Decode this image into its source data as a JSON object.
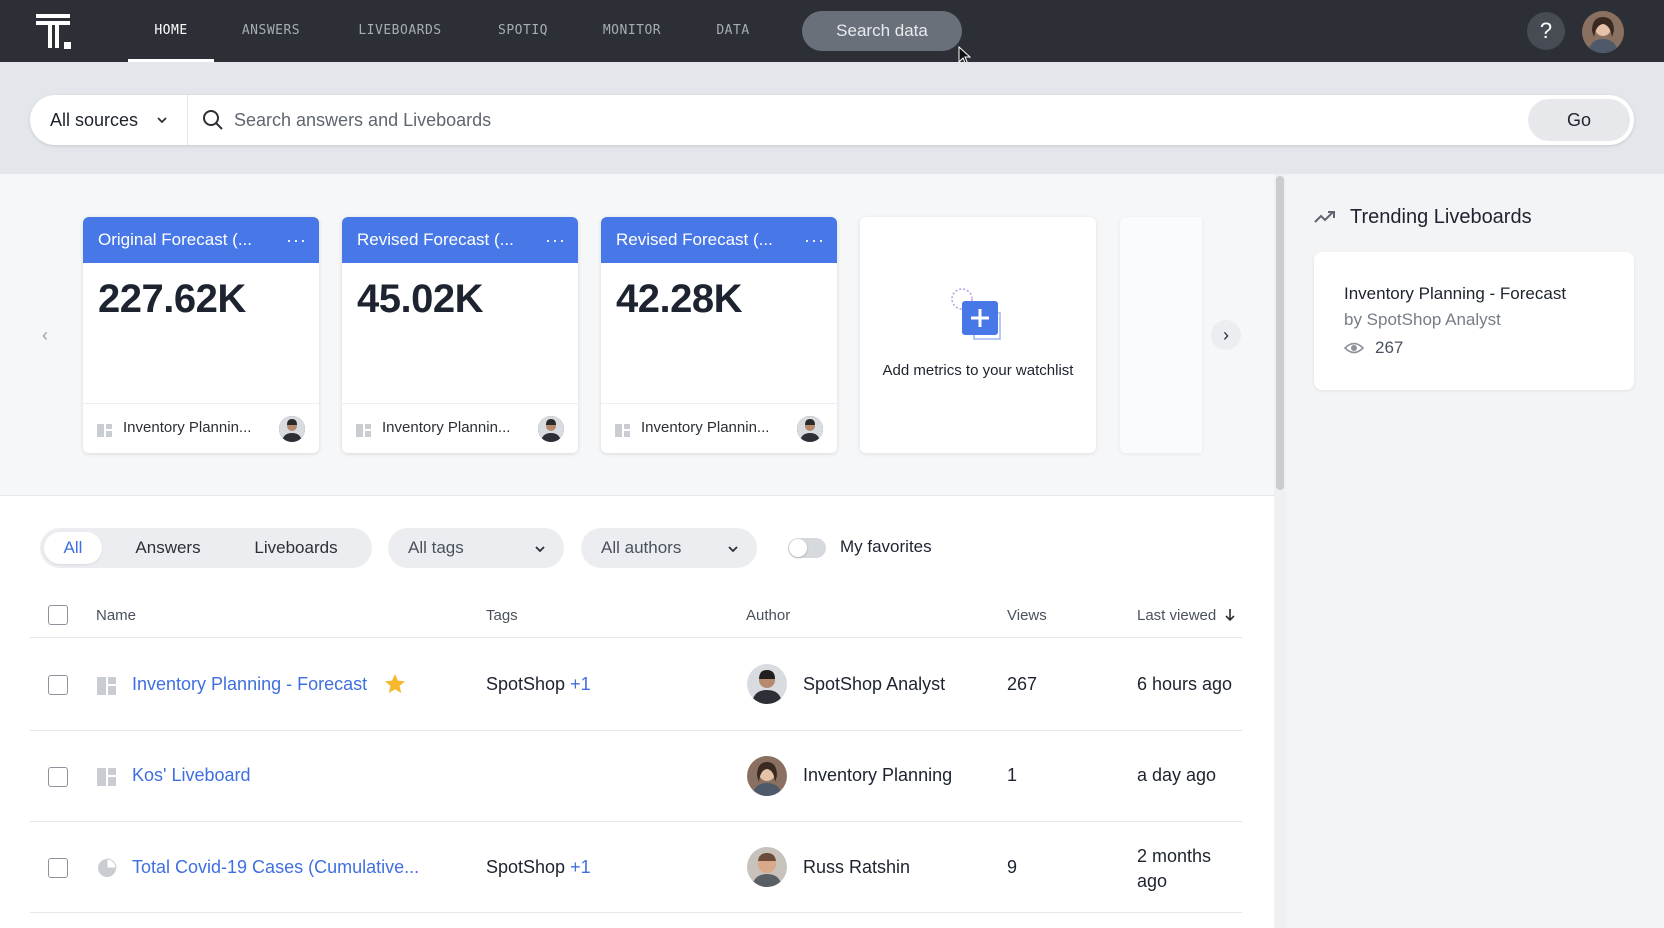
{
  "nav": {
    "tabs": [
      "HOME",
      "ANSWERS",
      "LIVEBOARDS",
      "SPOTIQ",
      "MONITOR",
      "DATA"
    ],
    "active_tab": "HOME",
    "search_label": "Search data",
    "help_label": "?"
  },
  "search": {
    "sources_label": "All sources",
    "placeholder": "Search answers and Liveboards",
    "go_label": "Go"
  },
  "watchlist": {
    "cards": [
      {
        "title": "Original Forecast (...",
        "value": "227.62K",
        "source": "Inventory Plannin..."
      },
      {
        "title": "Revised Forecast (...",
        "value": "45.02K",
        "source": "Inventory Plannin..."
      },
      {
        "title": "Revised Forecast (...",
        "value": "42.28K",
        "source": "Inventory Plannin..."
      }
    ],
    "more_label": "···",
    "add_text": "Add metrics to your watchlist",
    "prev_label": "‹",
    "next_label": "›"
  },
  "filters": {
    "segments": [
      "All",
      "Answers",
      "Liveboards"
    ],
    "active_segment": "All",
    "tags_label": "All tags",
    "authors_label": "All authors",
    "favorites_label": "My favorites"
  },
  "table": {
    "headers": {
      "name": "Name",
      "tags": "Tags",
      "author": "Author",
      "views": "Views",
      "last_viewed": "Last viewed"
    },
    "rows": [
      {
        "name": "Inventory Planning - Forecast",
        "favorite": true,
        "tag": "SpotShop",
        "tag_more": "+1",
        "author": "SpotShop Analyst",
        "views": "267",
        "last_viewed": "6 hours ago",
        "type": "liveboard"
      },
      {
        "name": "Kos' Liveboard",
        "favorite": false,
        "tag": "",
        "tag_more": "",
        "author": "Inventory Planning",
        "views": "1",
        "last_viewed": "a day ago",
        "type": "liveboard"
      },
      {
        "name": "Total Covid-19 Cases (Cumulative...",
        "favorite": false,
        "tag": "SpotShop",
        "tag_more": "+1",
        "author": "Russ Ratshin",
        "views": "9",
        "last_viewed_line1": "2 months",
        "last_viewed_line2": "ago",
        "type": "answer"
      }
    ]
  },
  "trending": {
    "title": "Trending Liveboards",
    "items": [
      {
        "name": "Inventory Planning - Forecast",
        "by": "by SpotShop Analyst",
        "views": "267"
      }
    ]
  },
  "colors": {
    "nav_bg": "#2c2f36",
    "accent": "#4878e8",
    "link": "#3f6fe0",
    "star": "#f5b82e"
  }
}
